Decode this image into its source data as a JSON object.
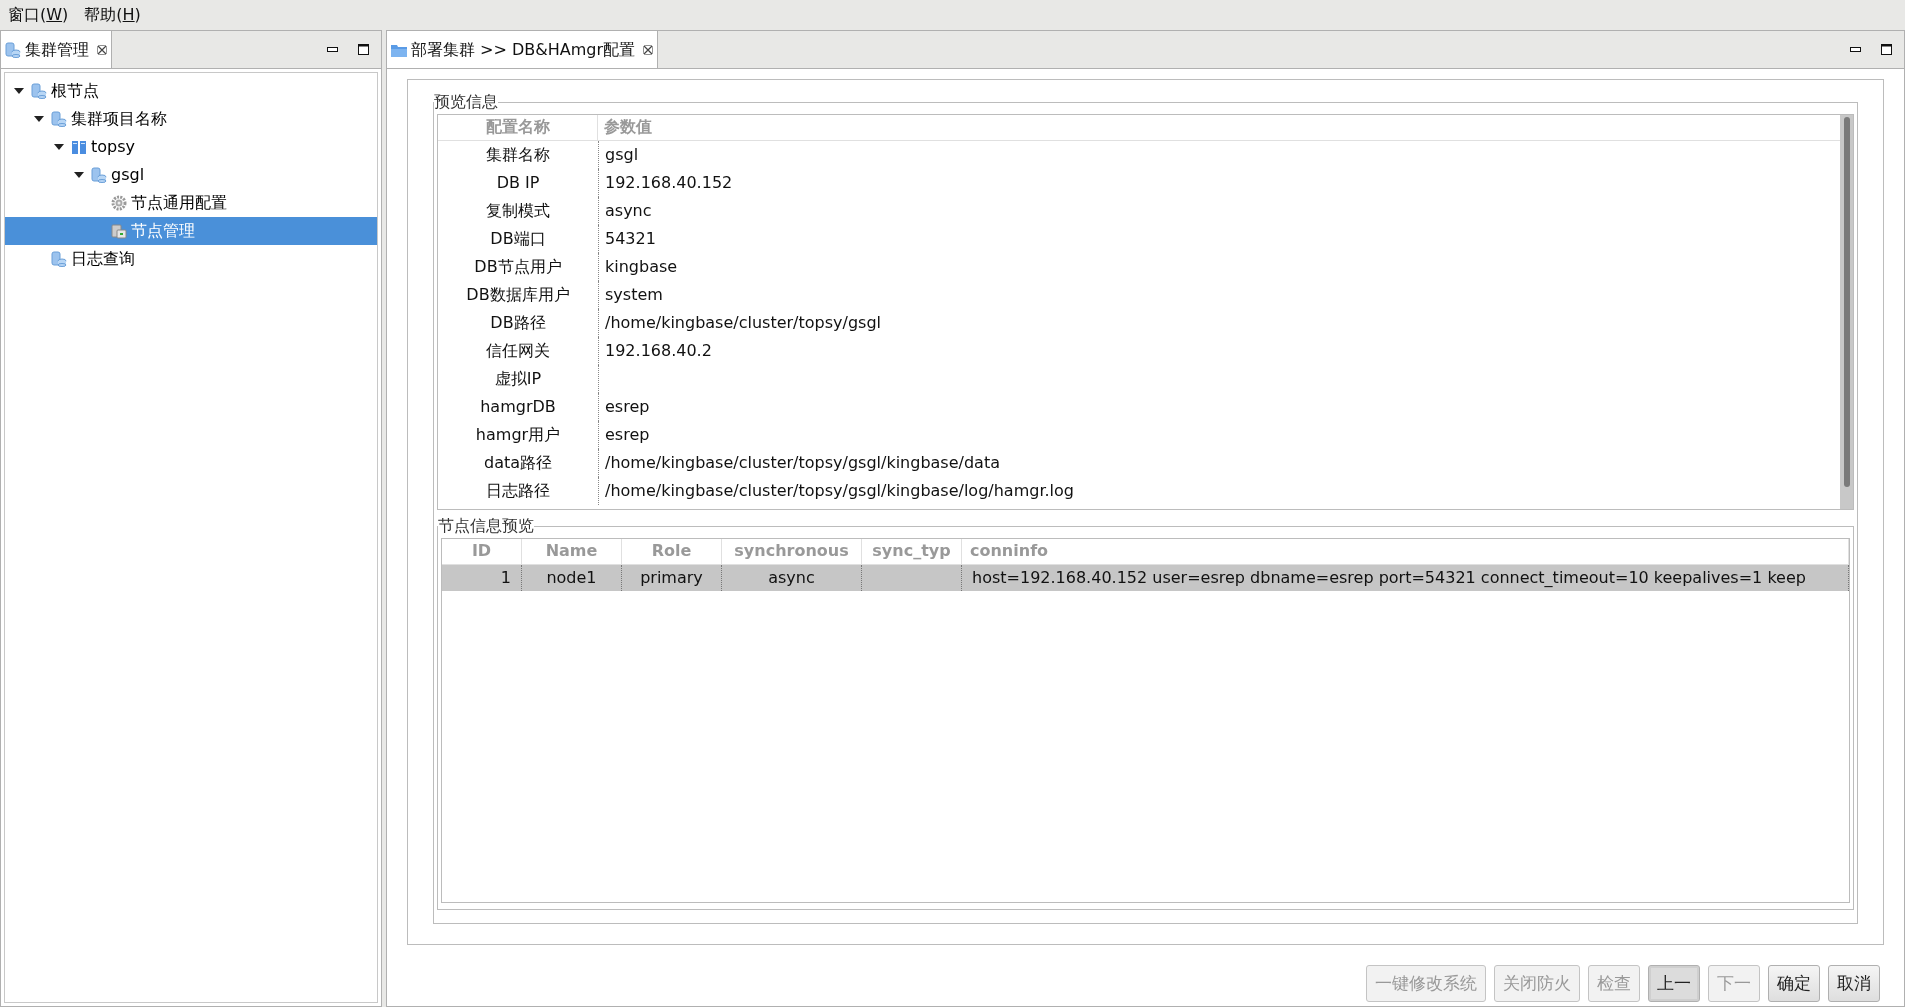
{
  "menu": [
    {
      "before": "窗口(",
      "key": "W",
      "after": ")"
    },
    {
      "before": "帮助(",
      "key": "H",
      "after": ")"
    }
  ],
  "left_panel": {
    "tab": {
      "label": "集群管理",
      "selected": true
    },
    "tree": [
      {
        "label": "根节点",
        "kind": "db",
        "expanded": true,
        "selected": false,
        "children": [
          {
            "label": "集群项目名称",
            "kind": "db",
            "expanded": true,
            "selected": false,
            "children": [
              {
                "label": "topsy",
                "kind": "server",
                "expanded": true,
                "selected": false,
                "children": [
                  {
                    "label": "gsgl",
                    "kind": "db",
                    "expanded": true,
                    "selected": false,
                    "children": [
                      {
                        "label": "节点通用配置",
                        "kind": "gear",
                        "selected": false
                      },
                      {
                        "label": "节点管理",
                        "kind": "node",
                        "selected": true
                      }
                    ]
                  }
                ]
              }
            ]
          },
          {
            "label": "日志查询",
            "kind": "db",
            "selected": false
          }
        ]
      }
    ]
  },
  "editor": {
    "tab": {
      "label": "部署集群 >> DB&HAmgr配置",
      "selected": true
    },
    "preview": {
      "title": "预览信息",
      "columns": [
        "配置名称",
        "参数值"
      ],
      "rows": [
        [
          "集群名称",
          "gsgl"
        ],
        [
          "DB IP",
          "192.168.40.152"
        ],
        [
          "复制模式",
          "async"
        ],
        [
          "DB端口",
          "54321"
        ],
        [
          "DB节点用户",
          "kingbase"
        ],
        [
          "DB数据库用户",
          "system"
        ],
        [
          "DB路径",
          "/home/kingbase/cluster/topsy/gsgl"
        ],
        [
          "信任网关",
          "192.168.40.2"
        ],
        [
          "虚拟IP",
          ""
        ],
        [
          "hamgrDB",
          "esrep"
        ],
        [
          "hamgr用户",
          "esrep"
        ],
        [
          "data路径",
          "/home/kingbase/cluster/topsy/gsgl/kingbase/data"
        ],
        [
          "日志路径",
          "/home/kingbase/cluster/topsy/gsgl/kingbase/log/hamgr.log"
        ]
      ]
    },
    "nodes": {
      "title": "节点信息预览",
      "columns": [
        "ID",
        "Name",
        "Role",
        "synchronous",
        "sync_typ",
        "conninfo"
      ],
      "rows": [
        {
          "selected": true,
          "cells": [
            "1",
            "node1",
            "primary",
            "async",
            "",
            "host=192.168.40.152 user=esrep dbname=esrep port=54321 connect_timeout=10 keepalives=1 keep"
          ]
        }
      ]
    },
    "buttons": [
      {
        "label": "一键修改系统",
        "disabled": true,
        "pressed": false
      },
      {
        "label": "关闭防火",
        "disabled": true,
        "pressed": false
      },
      {
        "label": "检查",
        "disabled": true,
        "pressed": false
      },
      {
        "label": "上一",
        "disabled": false,
        "pressed": true
      },
      {
        "label": "下一",
        "disabled": true,
        "pressed": false
      },
      {
        "label": "确定",
        "disabled": false,
        "pressed": false
      },
      {
        "label": "取消",
        "disabled": false,
        "pressed": false
      }
    ]
  }
}
